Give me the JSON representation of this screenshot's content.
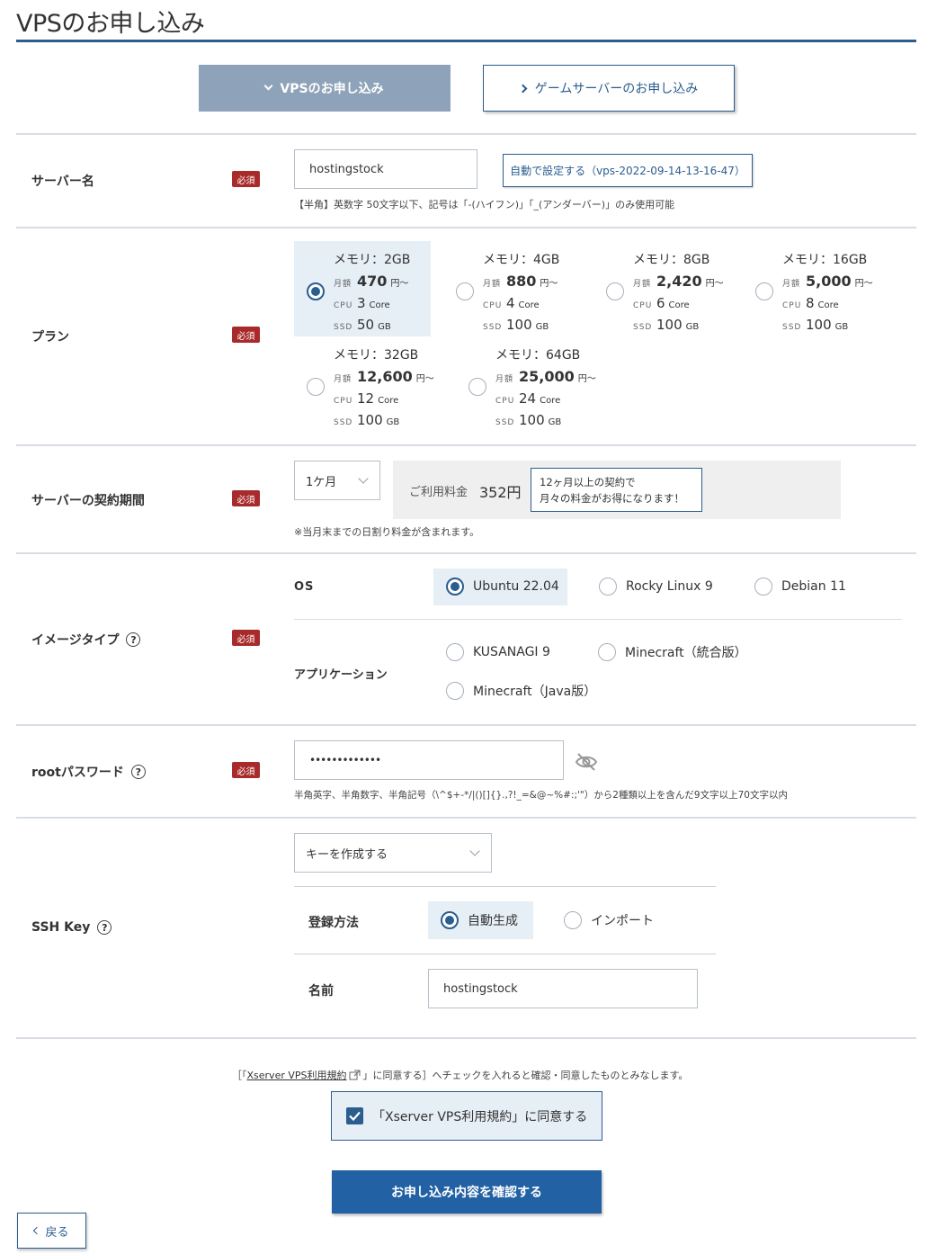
{
  "page_title": "VPSのお申し込み",
  "tabs": {
    "vps": "VPSのお申し込み",
    "game": "ゲームサーバーのお申し込み"
  },
  "server_name": {
    "label": "サーバー名",
    "required": "必須",
    "value": "hostingstock",
    "auto_button": "自動で設定する（vps-2022-09-14-13-16-47）",
    "note": "【半角】英数字 50文字以下、記号は「-(ハイフン)」「_(アンダーバー)」のみ使用可能"
  },
  "plan": {
    "label": "プラン",
    "required": "必須",
    "k_month": "月額",
    "k_cpu": "CPU",
    "k_ssd": "SSD",
    "u_yen": "円～",
    "u_core": "Core",
    "u_gb": "GB",
    "items": [
      {
        "mem": "メモリ：2GB",
        "price": "470",
        "cpu": "3",
        "ssd": "50"
      },
      {
        "mem": "メモリ：4GB",
        "price": "880",
        "cpu": "4",
        "ssd": "100"
      },
      {
        "mem": "メモリ：8GB",
        "price": "2,420",
        "cpu": "6",
        "ssd": "100"
      },
      {
        "mem": "メモリ：16GB",
        "price": "5,000",
        "cpu": "8",
        "ssd": "100"
      },
      {
        "mem": "メモリ：32GB",
        "price": "12,600",
        "cpu": "12",
        "ssd": "100"
      },
      {
        "mem": "メモリ：64GB",
        "price": "25,000",
        "cpu": "24",
        "ssd": "100"
      }
    ]
  },
  "period": {
    "label": "サーバーの契約期間",
    "required": "必須",
    "value": "1ケ月",
    "fee_label": "ご利用料金",
    "fee": "352円",
    "tip_line1": "12ヶ月以上の契約で",
    "tip_line2": "月々の料金がお得になります！",
    "note": "※当月末までの日割り料金が含まれます。"
  },
  "image": {
    "label": "イメージタイプ",
    "required": "必須",
    "help": "?",
    "os_label": "OS",
    "os": [
      "Ubuntu 22.04",
      "Rocky Linux 9",
      "Debian 11"
    ],
    "app_label": "アプリケーション",
    "apps": [
      "KUSANAGI 9",
      "Minecraft（統合版）",
      "Minecraft（Java版）"
    ]
  },
  "root": {
    "label": "rootパスワード",
    "required": "必須",
    "help": "?",
    "value": "•••••••••••••",
    "note": "半角英字、半角数字、半角記号（\\^$+-*/|()[]{}.,?!_=&@~%#:;'\"）から2種類以上を含んだ9文字以上70文字以内"
  },
  "ssh": {
    "label": "SSH Key",
    "help": "?",
    "dropdown": "キーを作成する",
    "method_label": "登録方法",
    "methods": [
      "自動生成",
      "インポート"
    ],
    "name_label": "名前",
    "name_value": "hostingstock"
  },
  "terms": {
    "note_pre": "［「",
    "link": "Xserver VPS利用規約",
    "note_post": "」に同意する］へチェックを入れると確認・同意したものとみなします。",
    "checkbox": "「Xserver VPS利用規約」に同意する"
  },
  "confirm_button": "お申し込み内容を確認する",
  "back_button": "戻る"
}
